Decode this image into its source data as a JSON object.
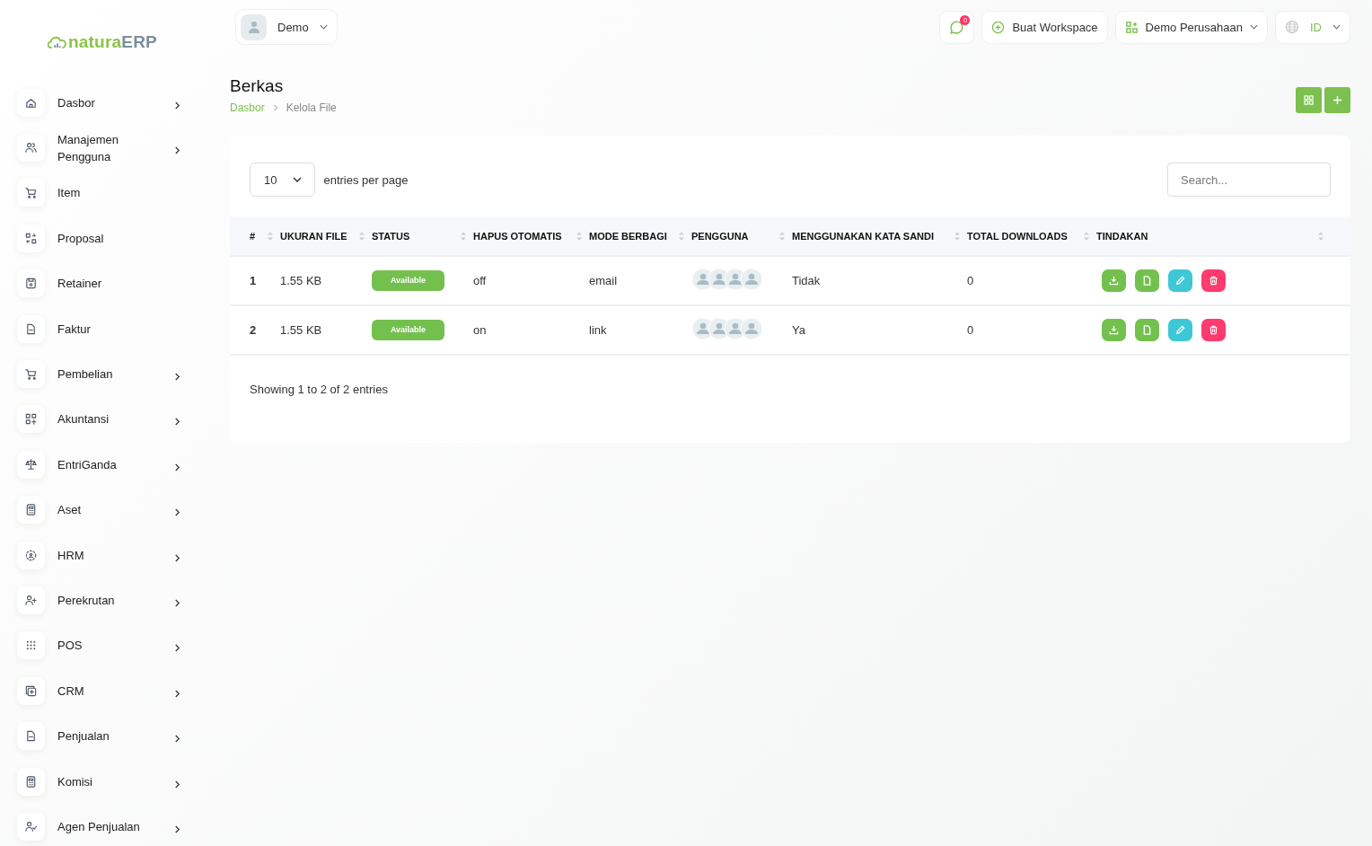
{
  "logo": {
    "brand": "natura",
    "suffix": "ERP"
  },
  "sidebar": {
    "items": [
      {
        "label": "Dasbor",
        "expandable": true
      },
      {
        "label": "Manajemen Pengguna",
        "expandable": true
      },
      {
        "label": "Item",
        "expandable": false
      },
      {
        "label": "Proposal",
        "expandable": false
      },
      {
        "label": "Retainer",
        "expandable": false
      },
      {
        "label": "Faktur",
        "expandable": false
      },
      {
        "label": "Pembelian",
        "expandable": true
      },
      {
        "label": "Akuntansi",
        "expandable": true
      },
      {
        "label": "EntriGanda",
        "expandable": true
      },
      {
        "label": "Aset",
        "expandable": true
      },
      {
        "label": "HRM",
        "expandable": true
      },
      {
        "label": "Perekrutan",
        "expandable": true
      },
      {
        "label": "POS",
        "expandable": true
      },
      {
        "label": "CRM",
        "expandable": true
      },
      {
        "label": "Penjualan",
        "expandable": true
      },
      {
        "label": "Komisi",
        "expandable": true
      },
      {
        "label": "Agen Penjualan",
        "expandable": true
      }
    ]
  },
  "topbar": {
    "user": "Demo",
    "notifications": "0",
    "create_workspace": "Buat Workspace",
    "company": "Demo Perusahaan",
    "language": "ID"
  },
  "page": {
    "title": "Berkas",
    "breadcrumb": [
      {
        "label": "Dasbor",
        "link": true
      },
      {
        "label": "Kelola File",
        "link": false
      }
    ]
  },
  "table": {
    "page_size": "10",
    "page_size_label": "entries per page",
    "search": {
      "placeholder": "Search..."
    },
    "columns": [
      {
        "label": "#",
        "sortable": true
      },
      {
        "label": "UKURAN FILE",
        "sortable": true
      },
      {
        "label": "STATUS",
        "sortable": true
      },
      {
        "label": "HAPUS OTOMATIS",
        "sortable": true
      },
      {
        "label": "MODE BERBAGI",
        "sortable": true
      },
      {
        "label": "PENGGUNA",
        "sortable": true
      },
      {
        "label": "MENGGUNAKAN KATA SANDI",
        "sortable": true
      },
      {
        "label": "TOTAL DOWNLOADS",
        "sortable": true
      },
      {
        "label": "TINDAKAN",
        "sortable": true
      }
    ],
    "rows": [
      {
        "index": "1",
        "size": "1.55 KB",
        "status": "Available",
        "auto_delete": "off",
        "share_mode": "email",
        "password": "Tidak",
        "downloads": "0",
        "actions": [
          {
            "kind": "download"
          },
          {
            "kind": "file"
          },
          {
            "kind": "edit"
          },
          {
            "kind": "delete"
          }
        ]
      },
      {
        "index": "2",
        "size": "1.55 KB",
        "status": "Available",
        "auto_delete": "on",
        "share_mode": "link",
        "password": "Ya",
        "downloads": "0",
        "actions": [
          {
            "kind": "download"
          },
          {
            "kind": "file"
          },
          {
            "kind": "edit"
          },
          {
            "kind": "delete"
          }
        ]
      }
    ],
    "footer": "Showing 1 to 2 of 2 entries"
  }
}
